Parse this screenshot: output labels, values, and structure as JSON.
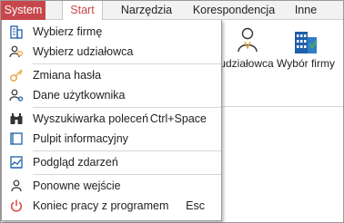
{
  "tabs": {
    "system": "System",
    "start": "Start",
    "narzedzia": "Narzędzia",
    "korespondencja": "Korespondencja",
    "inne": "Inne"
  },
  "ribbon": {
    "wybor_udzialowca": "udziałowca",
    "wybor_firmy": "Wybór firmy"
  },
  "menu": {
    "wybierz_firme": "Wybierz firmę",
    "wybierz_udzialowca": "Wybierz udziałowca",
    "zmiana_hasla": "Zmiana hasła",
    "dane_uzytkownika": "Dane użytkownika",
    "wyszukiwarka": "Wyszukiwarka poleceń",
    "wyszukiwarka_shortcut": "Ctrl+Space",
    "pulpit": "Pulpit informacyjny",
    "podglad": "Podgląd zdarzeń",
    "ponowne": "Ponowne wejście",
    "koniec": "Koniec pracy z programem",
    "koniec_shortcut": "Esc"
  },
  "colors": {
    "accent": "#c8474c",
    "icon_blue": "#1f5fa8",
    "icon_orange": "#e8a23a",
    "icon_green": "#4aa564",
    "icon_red": "#d9453b"
  }
}
